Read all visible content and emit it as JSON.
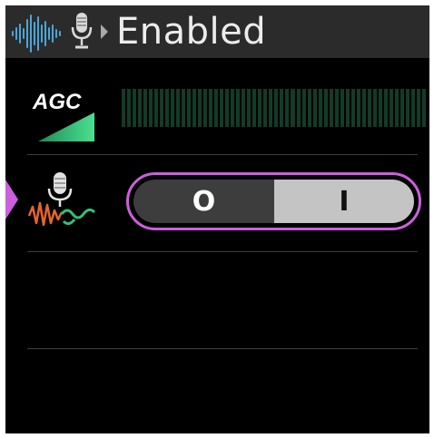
{
  "header": {
    "title": "Enabled",
    "icons": [
      "audio-waveform-icon",
      "microphone-icon",
      "caret-right-icon"
    ]
  },
  "agc_row": {
    "icon_label": "AGC",
    "icon": "agc-ramp-icon",
    "meter_level": 0,
    "meter_color": "#143a28"
  },
  "noise_row": {
    "icon": "microphone-noise-icon",
    "selected": true,
    "toggle": {
      "off_symbol": "O",
      "on_symbol": "I",
      "state": "on",
      "border_color": "#cc5fdd"
    }
  },
  "colors": {
    "accent": "#cc5fdd",
    "header_bg": "#2b2b2b",
    "background": "#000000"
  }
}
